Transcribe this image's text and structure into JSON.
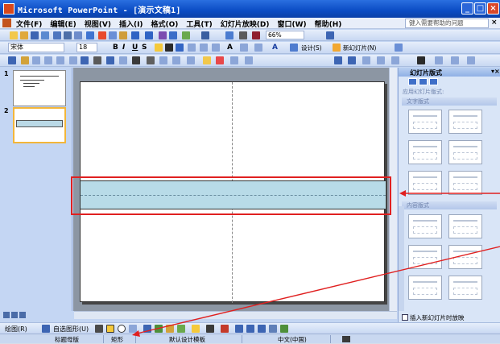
{
  "window": {
    "title": "Microsoft PowerPoint - [演示文稿1]"
  },
  "menu": {
    "items": [
      "文件(F)",
      "编辑(E)",
      "视图(V)",
      "插入(I)",
      "格式(O)",
      "工具(T)",
      "幻灯片放映(D)",
      "窗口(W)",
      "帮助(H)"
    ],
    "help_placeholder": "键入需要帮助的问题"
  },
  "toolbar": {
    "zoom": "66%",
    "font_name": "宋体",
    "font_size": "18",
    "bold": "B",
    "italic": "I",
    "underline": "U",
    "shadow": "S",
    "font_size_up": "A",
    "font_color": "A",
    "design_label": "设计(S)",
    "new_slide_label": "新幻灯片(N)"
  },
  "slides_pane": {
    "items": [
      {
        "number": "1"
      },
      {
        "number": "2"
      }
    ]
  },
  "task_pane": {
    "title": "幻灯片版式",
    "subtitle": "应用幻灯片版式:",
    "sections": [
      "文字版式",
      "内容版式"
    ],
    "checkbox_label": "插入新幻灯片时放映"
  },
  "draw_toolbar": {
    "draw": "绘图(R)",
    "autoshapes": "自选图形(U)"
  },
  "status": {
    "master": "标题母版",
    "shape": "矩形",
    "template": "默认设计模板",
    "language": "中文(中国)"
  },
  "colors": {
    "titlebar": "#0b4cc4",
    "highlight_red": "#e02020",
    "band": "#b8dbe8"
  }
}
